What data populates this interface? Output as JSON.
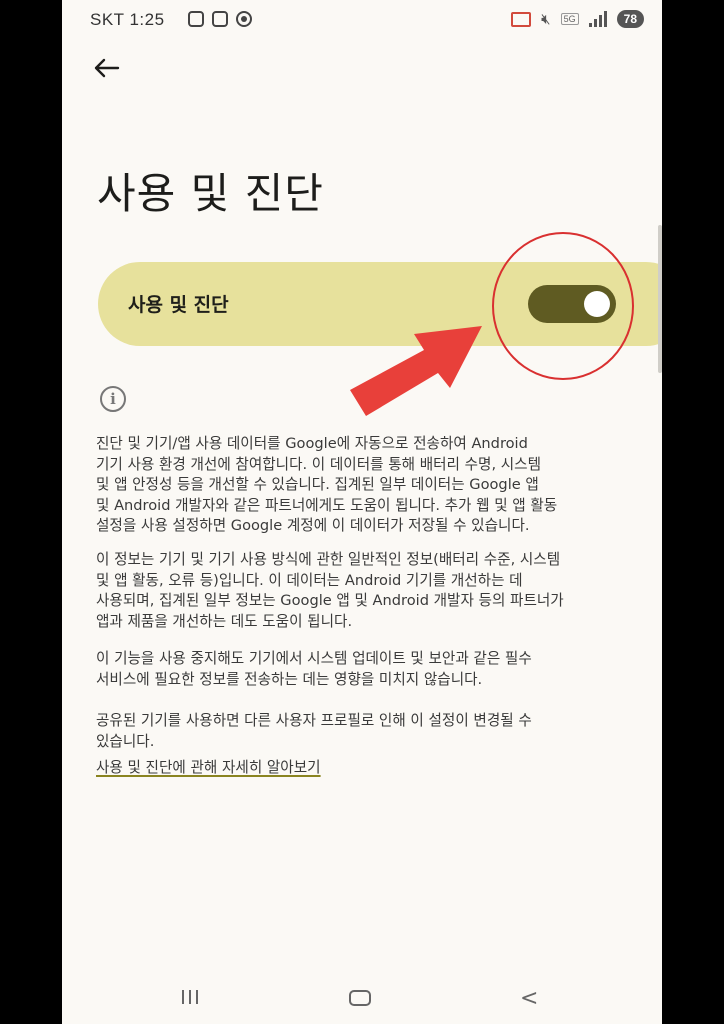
{
  "status_bar": {
    "carrier_time": "SKT 1:25",
    "battery": "78",
    "network_label": "5G"
  },
  "header": {
    "back_icon": "arrow-left-icon",
    "title": "사용 및 진단"
  },
  "toggle": {
    "label": "사용 및 진단",
    "state": "on"
  },
  "info_icon": "info-icon",
  "paragraphs": [
    "진단 및 기기/앱 사용 데이터를 Google에 자동으로 전송하여 Android\n기기 사용 환경 개선에 참여합니다. 이 데이터를 통해 배터리 수명, 시스템\n및 앱 안정성 등을 개선할 수 있습니다. 집계된 일부 데이터는 Google 앱\n및 Android 개발자와 같은 파트너에게도 도움이 됩니다. 추가 웹 및 앱 활동\n설정을 사용 설정하면 Google 계정에 이 데이터가 저장될 수 있습니다.",
    "이 정보는 기기 및 기기 사용 방식에 관한 일반적인 정보(배터리 수준, 시스템\n및 앱 활동, 오류 등)입니다. 이 데이터는 Android 기기를 개선하는 데\n사용되며, 집계된 일부 정보는 Google 앱 및 Android 개발자 등의 파트너가\n앱과 제품을 개선하는 데도 도움이 됩니다.",
    "이 기능을 사용 중지해도 기기에서 시스템 업데이트 및 보안과 같은 필수\n서비스에 필요한 정보를 전송하는 데는 영향을 미치지 않습니다.",
    "공유된 기기를 사용하면 다른 사용자 프로필로 인해 이 설정이 변경될 수\n있습니다."
  ],
  "learn_more_link": "사용 및 진단에 관해 자세히 알아보기",
  "annotation_colors": {
    "arrow": "#e8403a",
    "circle": "#d93030"
  },
  "nav_bar": {
    "recents_icon": "recents-icon",
    "home_icon": "home-icon",
    "back_icon": "back-chevron-icon"
  }
}
